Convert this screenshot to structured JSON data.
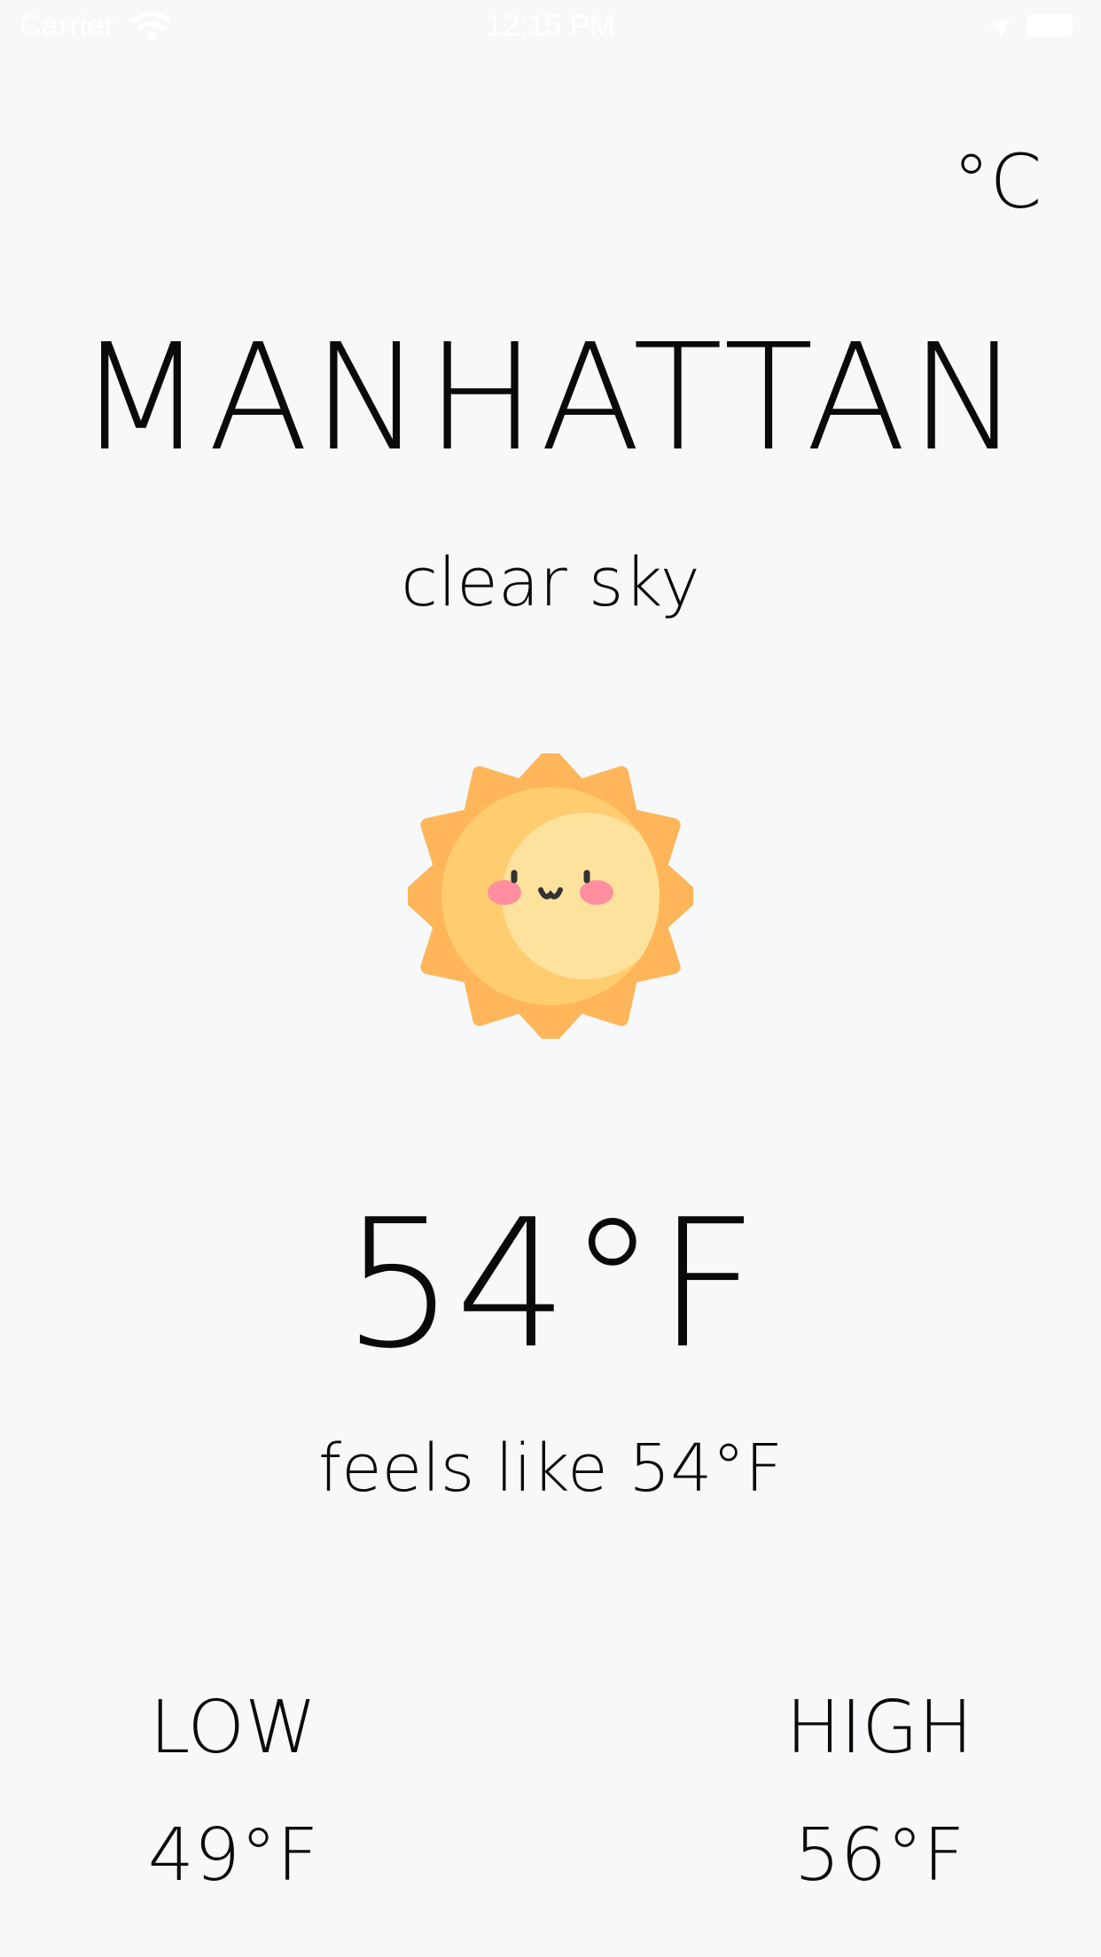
{
  "status_bar": {
    "carrier": "Carrier",
    "time": "12:15 PM",
    "wifi_icon": "wifi-icon",
    "location_icon": "location-arrow-icon",
    "battery_icon": "battery-icon"
  },
  "unit_toggle": {
    "label": "°C"
  },
  "location": {
    "city": "MANHATTAN",
    "condition": "clear sky"
  },
  "weather_icon": {
    "name": "smiling-sun-icon",
    "colors": {
      "rays": "#FFB55A",
      "face_outer": "#FFCC70",
      "face_inner": "#FDE29D",
      "cheeks": "#FF8E9E",
      "features": "#333333"
    }
  },
  "current": {
    "temperature": "54°F",
    "feels_like": "feels like 54°F"
  },
  "range": {
    "low_label": "LOW",
    "low_value": "49°F",
    "high_label": "HIGH",
    "high_value": "56°F"
  },
  "colors": {
    "background": "#F7F8FA",
    "text": "#0A0A0A"
  }
}
